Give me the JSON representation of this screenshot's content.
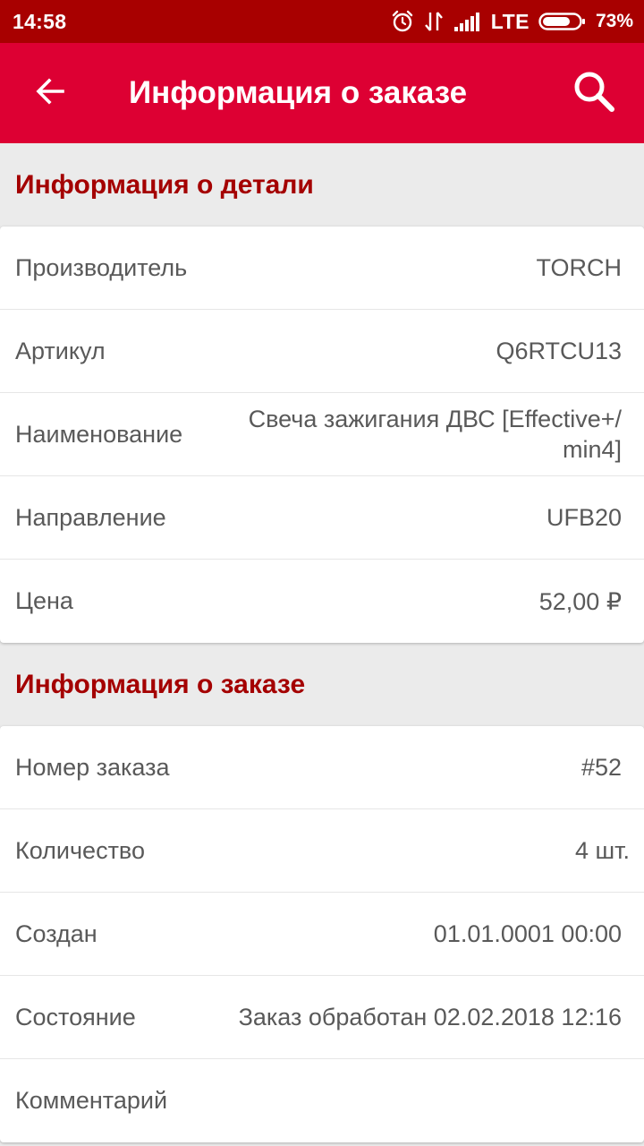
{
  "status_bar": {
    "time": "14:58",
    "network": "LTE",
    "battery": "73%",
    "icons": [
      "alarm-icon",
      "data-arrows-icon",
      "signal-icon",
      "battery-icon"
    ]
  },
  "app_bar": {
    "title": "Информация о заказе",
    "back_icon": "arrow-back-icon",
    "search_icon": "search-icon"
  },
  "part_section": {
    "header": "Информация о детали",
    "rows": [
      {
        "label": "Производитель",
        "value": "TORCH"
      },
      {
        "label": "Артикул",
        "value": "Q6RTCU13"
      },
      {
        "label": "Наименование",
        "value": "Свеча зажигания ДВС [Effective+/ min4]"
      },
      {
        "label": "Направление",
        "value": "UFB20"
      },
      {
        "label": "Цена",
        "value": "52,00 ₽"
      }
    ]
  },
  "order_section": {
    "header": "Информация о заказе",
    "rows": [
      {
        "label": "Номер заказа",
        "value": "#52"
      },
      {
        "label": "Количество",
        "value": "4 шт."
      },
      {
        "label": "Создан",
        "value": "01.01.0001 00:00"
      },
      {
        "label": "Состояние",
        "value": "Заказ обработан 02.02.2018 12:16"
      },
      {
        "label": "Комментарий",
        "value": ""
      }
    ]
  },
  "colors": {
    "status_bar": "#a80000",
    "app_bar": "#dd0033",
    "section_header_text": "#a40000",
    "background": "#ebebeb"
  }
}
